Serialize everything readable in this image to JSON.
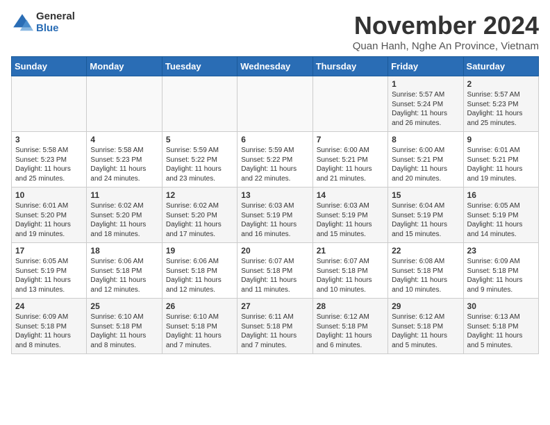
{
  "logo": {
    "general": "General",
    "blue": "Blue"
  },
  "title": "November 2024",
  "subtitle": "Quan Hanh, Nghe An Province, Vietnam",
  "days_of_week": [
    "Sunday",
    "Monday",
    "Tuesday",
    "Wednesday",
    "Thursday",
    "Friday",
    "Saturday"
  ],
  "weeks": [
    [
      {
        "day": "",
        "info": ""
      },
      {
        "day": "",
        "info": ""
      },
      {
        "day": "",
        "info": ""
      },
      {
        "day": "",
        "info": ""
      },
      {
        "day": "",
        "info": ""
      },
      {
        "day": "1",
        "info": "Sunrise: 5:57 AM\nSunset: 5:24 PM\nDaylight: 11 hours and 26 minutes."
      },
      {
        "day": "2",
        "info": "Sunrise: 5:57 AM\nSunset: 5:23 PM\nDaylight: 11 hours and 25 minutes."
      }
    ],
    [
      {
        "day": "3",
        "info": "Sunrise: 5:58 AM\nSunset: 5:23 PM\nDaylight: 11 hours and 25 minutes."
      },
      {
        "day": "4",
        "info": "Sunrise: 5:58 AM\nSunset: 5:23 PM\nDaylight: 11 hours and 24 minutes."
      },
      {
        "day": "5",
        "info": "Sunrise: 5:59 AM\nSunset: 5:22 PM\nDaylight: 11 hours and 23 minutes."
      },
      {
        "day": "6",
        "info": "Sunrise: 5:59 AM\nSunset: 5:22 PM\nDaylight: 11 hours and 22 minutes."
      },
      {
        "day": "7",
        "info": "Sunrise: 6:00 AM\nSunset: 5:21 PM\nDaylight: 11 hours and 21 minutes."
      },
      {
        "day": "8",
        "info": "Sunrise: 6:00 AM\nSunset: 5:21 PM\nDaylight: 11 hours and 20 minutes."
      },
      {
        "day": "9",
        "info": "Sunrise: 6:01 AM\nSunset: 5:21 PM\nDaylight: 11 hours and 19 minutes."
      }
    ],
    [
      {
        "day": "10",
        "info": "Sunrise: 6:01 AM\nSunset: 5:20 PM\nDaylight: 11 hours and 19 minutes."
      },
      {
        "day": "11",
        "info": "Sunrise: 6:02 AM\nSunset: 5:20 PM\nDaylight: 11 hours and 18 minutes."
      },
      {
        "day": "12",
        "info": "Sunrise: 6:02 AM\nSunset: 5:20 PM\nDaylight: 11 hours and 17 minutes."
      },
      {
        "day": "13",
        "info": "Sunrise: 6:03 AM\nSunset: 5:19 PM\nDaylight: 11 hours and 16 minutes."
      },
      {
        "day": "14",
        "info": "Sunrise: 6:03 AM\nSunset: 5:19 PM\nDaylight: 11 hours and 15 minutes."
      },
      {
        "day": "15",
        "info": "Sunrise: 6:04 AM\nSunset: 5:19 PM\nDaylight: 11 hours and 15 minutes."
      },
      {
        "day": "16",
        "info": "Sunrise: 6:05 AM\nSunset: 5:19 PM\nDaylight: 11 hours and 14 minutes."
      }
    ],
    [
      {
        "day": "17",
        "info": "Sunrise: 6:05 AM\nSunset: 5:19 PM\nDaylight: 11 hours and 13 minutes."
      },
      {
        "day": "18",
        "info": "Sunrise: 6:06 AM\nSunset: 5:18 PM\nDaylight: 11 hours and 12 minutes."
      },
      {
        "day": "19",
        "info": "Sunrise: 6:06 AM\nSunset: 5:18 PM\nDaylight: 11 hours and 12 minutes."
      },
      {
        "day": "20",
        "info": "Sunrise: 6:07 AM\nSunset: 5:18 PM\nDaylight: 11 hours and 11 minutes."
      },
      {
        "day": "21",
        "info": "Sunrise: 6:07 AM\nSunset: 5:18 PM\nDaylight: 11 hours and 10 minutes."
      },
      {
        "day": "22",
        "info": "Sunrise: 6:08 AM\nSunset: 5:18 PM\nDaylight: 11 hours and 10 minutes."
      },
      {
        "day": "23",
        "info": "Sunrise: 6:09 AM\nSunset: 5:18 PM\nDaylight: 11 hours and 9 minutes."
      }
    ],
    [
      {
        "day": "24",
        "info": "Sunrise: 6:09 AM\nSunset: 5:18 PM\nDaylight: 11 hours and 8 minutes."
      },
      {
        "day": "25",
        "info": "Sunrise: 6:10 AM\nSunset: 5:18 PM\nDaylight: 11 hours and 8 minutes."
      },
      {
        "day": "26",
        "info": "Sunrise: 6:10 AM\nSunset: 5:18 PM\nDaylight: 11 hours and 7 minutes."
      },
      {
        "day": "27",
        "info": "Sunrise: 6:11 AM\nSunset: 5:18 PM\nDaylight: 11 hours and 7 minutes."
      },
      {
        "day": "28",
        "info": "Sunrise: 6:12 AM\nSunset: 5:18 PM\nDaylight: 11 hours and 6 minutes."
      },
      {
        "day": "29",
        "info": "Sunrise: 6:12 AM\nSunset: 5:18 PM\nDaylight: 11 hours and 5 minutes."
      },
      {
        "day": "30",
        "info": "Sunrise: 6:13 AM\nSunset: 5:18 PM\nDaylight: 11 hours and 5 minutes."
      }
    ]
  ]
}
